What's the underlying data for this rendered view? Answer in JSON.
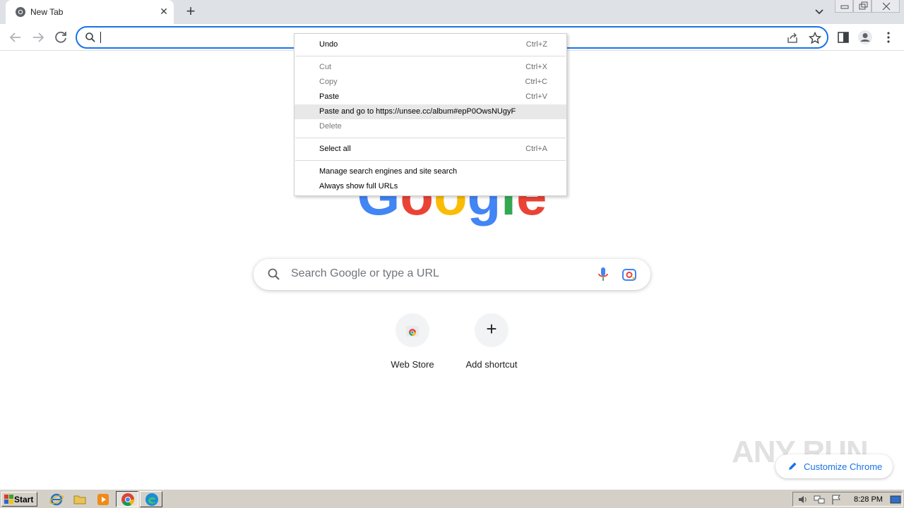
{
  "browser": {
    "tab": {
      "title": "New Tab",
      "close_symbol": "✕"
    },
    "new_tab_symbol": "+",
    "window_controls": [
      "minimize-icon",
      "restore-icon",
      "close-icon"
    ],
    "omnibox": {
      "value": ""
    }
  },
  "newtab_page": {
    "logo_text": "Google",
    "logo_colors": [
      "#4285f4",
      "#ea4335",
      "#fbbc05",
      "#4285f4",
      "#34a853",
      "#ea4335"
    ],
    "search_placeholder": "Search Google or type a URL",
    "shortcuts": [
      {
        "label": "Web Store",
        "icon": "web-store-icon"
      },
      {
        "label": "Add shortcut",
        "icon": "plus-icon",
        "symbol": "+"
      }
    ],
    "customize_label": "Customize Chrome"
  },
  "context_menu": {
    "items": [
      {
        "label": "Undo",
        "shortcut": "Ctrl+Z",
        "enabled": true
      },
      {
        "label": "Cut",
        "shortcut": "Ctrl+X",
        "enabled": false
      },
      {
        "label": "Copy",
        "shortcut": "Ctrl+C",
        "enabled": false
      },
      {
        "label": "Paste",
        "shortcut": "Ctrl+V",
        "enabled": true
      },
      {
        "label": "Paste and go to https://unsee.cc/album#epP0OwsNUgyF",
        "shortcut": "",
        "enabled": true,
        "highlighted": true
      },
      {
        "label": "Delete",
        "shortcut": "",
        "enabled": false
      },
      {
        "label": "Select all",
        "shortcut": "Ctrl+A",
        "enabled": true
      },
      {
        "label": "Manage search engines and site search",
        "shortcut": "",
        "enabled": true
      },
      {
        "label": "Always show full URLs",
        "shortcut": "",
        "enabled": true
      }
    ]
  },
  "watermark": "ANY RUN",
  "taskbar": {
    "start_label": "Start",
    "quick_launch": [
      "ie-icon",
      "folder-icon",
      "media-player-icon"
    ],
    "tasks": [
      "chrome-icon",
      "edge-icon"
    ],
    "clock": "8:28 PM"
  }
}
